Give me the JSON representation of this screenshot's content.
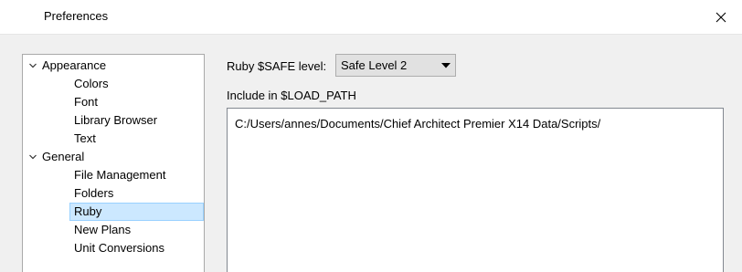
{
  "window": {
    "title": "Preferences"
  },
  "tree": {
    "items": [
      {
        "label": "Appearance",
        "level": 0,
        "expanded": true
      },
      {
        "label": "Colors",
        "level": 1
      },
      {
        "label": "Font",
        "level": 1
      },
      {
        "label": "Library Browser",
        "level": 1
      },
      {
        "label": "Text",
        "level": 1
      },
      {
        "label": "General",
        "level": 0,
        "expanded": true
      },
      {
        "label": "File Management",
        "level": 1
      },
      {
        "label": "Folders",
        "level": 1
      },
      {
        "label": "Ruby",
        "level": 1,
        "selected": true
      },
      {
        "label": "New Plans",
        "level": 1
      },
      {
        "label": "Unit Conversions",
        "level": 1
      }
    ]
  },
  "ruby": {
    "safe_label": "Ruby $SAFE level:",
    "safe_value": "Safe Level 2",
    "load_path_label": "Include in $LOAD_PATH",
    "load_path_value": "C:/Users/annes/Documents/Chief Architect Premier X14 Data/Scripts/"
  },
  "colors": {
    "selection_bg": "#cce8ff",
    "selection_border": "#99d1ff",
    "panel_bg": "#f0f0f0"
  },
  "icons": {
    "close": "close-icon",
    "expand": "chevron-down-icon",
    "dropdown": "dropdown-arrow-icon"
  }
}
